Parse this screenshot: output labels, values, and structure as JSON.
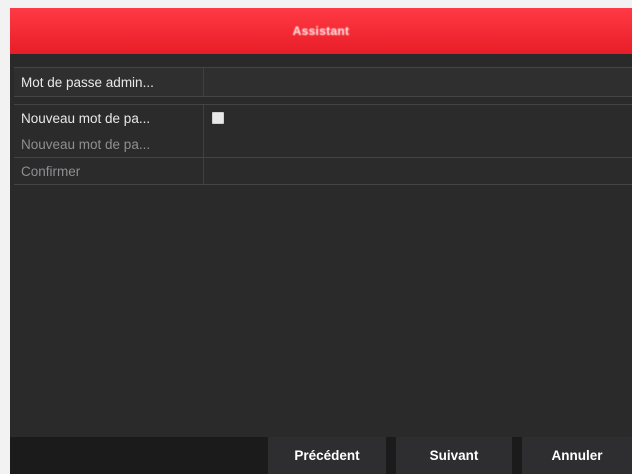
{
  "window": {
    "title": "Assistant"
  },
  "form": {
    "admin_password_label": "Mot de passe admin...",
    "admin_password_value": "",
    "new_password_toggle_label": "Nouveau mot de pa...",
    "new_password_toggle_checked": true,
    "new_password_label": "Nouveau mot de pa...",
    "new_password_value": "",
    "confirm_label": "Confirmer",
    "confirm_value": ""
  },
  "footer": {
    "prev_label": "Précédent",
    "next_label": "Suivant",
    "cancel_label": "Annuler"
  },
  "colors": {
    "accent": "#e81d28",
    "panel": "#2a2a2b",
    "footer": "#1b1b1c"
  }
}
